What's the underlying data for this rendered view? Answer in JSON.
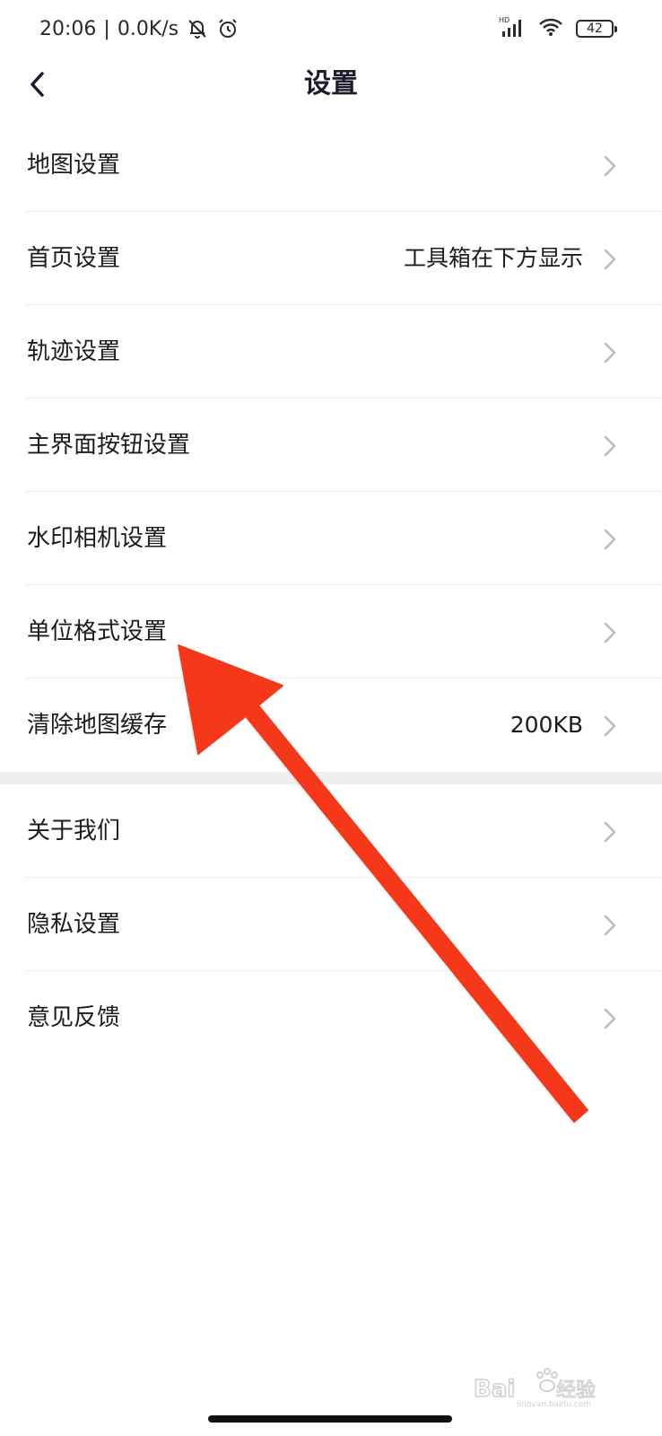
{
  "status_bar": {
    "time": "20:06",
    "network_speed": "0.0K/s",
    "battery_level": "42",
    "icons": [
      "bell-off-icon",
      "alarm-icon",
      "hd-signal-icon",
      "wifi-icon",
      "battery-icon"
    ]
  },
  "header": {
    "title": "设置",
    "back_icon": "chevron-left-icon"
  },
  "settings": {
    "group1": [
      {
        "label": "地图设置",
        "value": ""
      },
      {
        "label": "首页设置",
        "value": "工具箱在下方显示"
      },
      {
        "label": "轨迹设置",
        "value": ""
      },
      {
        "label": "主界面按钮设置",
        "value": ""
      },
      {
        "label": "水印相机设置",
        "value": ""
      },
      {
        "label": "单位格式设置",
        "value": ""
      },
      {
        "label": "清除地图缓存",
        "value": "200KB"
      }
    ],
    "group2": [
      {
        "label": "关于我们",
        "value": ""
      },
      {
        "label": "隐私设置",
        "value": ""
      },
      {
        "label": "意见反馈",
        "value": ""
      }
    ]
  },
  "annotation": {
    "arrow_color": "#f5371a",
    "icon": "red-arrow-annotation"
  },
  "colors": {
    "title": "#1d1b2e",
    "chevron": "#b8b8bd",
    "divider": "#ededed",
    "section_gap": "#efefef"
  }
}
